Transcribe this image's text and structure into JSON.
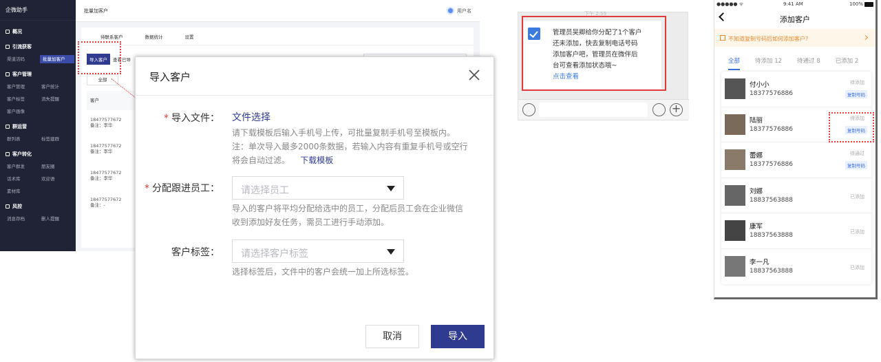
{
  "admin": {
    "brand": "企微助手",
    "topbar": {
      "title": "批量加客户",
      "user": "用户名"
    },
    "sidebar": {
      "groups": [
        {
          "title": "概况",
          "items": []
        },
        {
          "title": "引流获客",
          "items": [
            "渠道活码",
            "批量加客户"
          ]
        },
        {
          "title": "客户管理",
          "items": [
            "客户管理",
            "客户统计",
            "客户标签",
            "流失提醒",
            "客户画像"
          ]
        },
        {
          "title": "群运营",
          "items": [
            "群列表",
            "标签建群"
          ]
        },
        {
          "title": "客户转化",
          "items": [
            "客户群发",
            "朋友圈",
            "话术库",
            "欢迎语",
            "素材库"
          ]
        },
        {
          "title": "风控",
          "items": [
            "消息存档",
            "删人提醒"
          ]
        }
      ],
      "active_item": "批量加客户"
    },
    "tabs": [
      "待联系客户",
      "数据统计",
      "设置"
    ],
    "import_button": "导入客户",
    "import_hint": "查看已导",
    "subtab": "全部",
    "table_header": "客户",
    "rows": [
      {
        "phone": "18477577672",
        "note": "备注：李华"
      },
      {
        "phone": "18477577672",
        "note": "备注：李华"
      },
      {
        "phone": "18477577672",
        "note": "备注：李华"
      },
      {
        "phone": "18477577672",
        "note": "备注：-"
      }
    ]
  },
  "modal": {
    "title": "导入客户",
    "file_label": "导入文件：",
    "file_link": "文件选择",
    "file_hint1": "请下载模板后输入手机号上传，可批量复制手机号至模板内。",
    "file_hint2": "注：单次导入最多2000条数据，若输入内容有重复手机号或空行",
    "file_hint3": "将会自动过滤。",
    "download_link": "下载模板",
    "staff_label": "分配跟进员工：",
    "staff_placeholder": "请选择员工",
    "staff_hint1": "导入的客户将平均分配给选中的员工，分配后员工会在企业微信",
    "staff_hint2": "收到添加好友任务，需员工进行手动添加。",
    "tag_label": "客户标签：",
    "tag_placeholder": "请选择客户标签",
    "tag_hint": "选择标签后，文件中的客户会统一加上所选标签。",
    "cancel": "取消",
    "ok": "导入"
  },
  "chat": {
    "time_hint": "下午 2:59",
    "lines": [
      "管理员吴卿给你分配了1个客户",
      "还未添加，快去复制电话号码",
      "添加客户吧，管理员在微伴后",
      "台可查看添加状态哦~"
    ],
    "link": "点击查看"
  },
  "phone": {
    "status": {
      "carrier": "●●●●● ᯤ",
      "time": "9:41 AM",
      "battery": "100%"
    },
    "title": "添加客户",
    "tip": "不知道复制号码后如何添加客户?",
    "tabs": [
      "全部",
      "待添加 12",
      "待通过 8",
      "已添加 2"
    ],
    "contacts": [
      {
        "name": "付小小",
        "phone": "18377576886",
        "status": "待添加",
        "button": "复制号码"
      },
      {
        "name": "陆丽",
        "phone": "18377576886",
        "status": "待添加",
        "button": "复制号码"
      },
      {
        "name": "蕾娜",
        "phone": "18377576886",
        "status": "待通过",
        "button": "复制号码"
      },
      {
        "name": "刘娜",
        "phone": "18837563888",
        "status": "已添加",
        "button": ""
      },
      {
        "name": "康军",
        "phone": "18837563888",
        "status": "已添加",
        "button": ""
      },
      {
        "name": "李一凡",
        "phone": "18837563888",
        "status": "已添加",
        "button": ""
      }
    ]
  }
}
